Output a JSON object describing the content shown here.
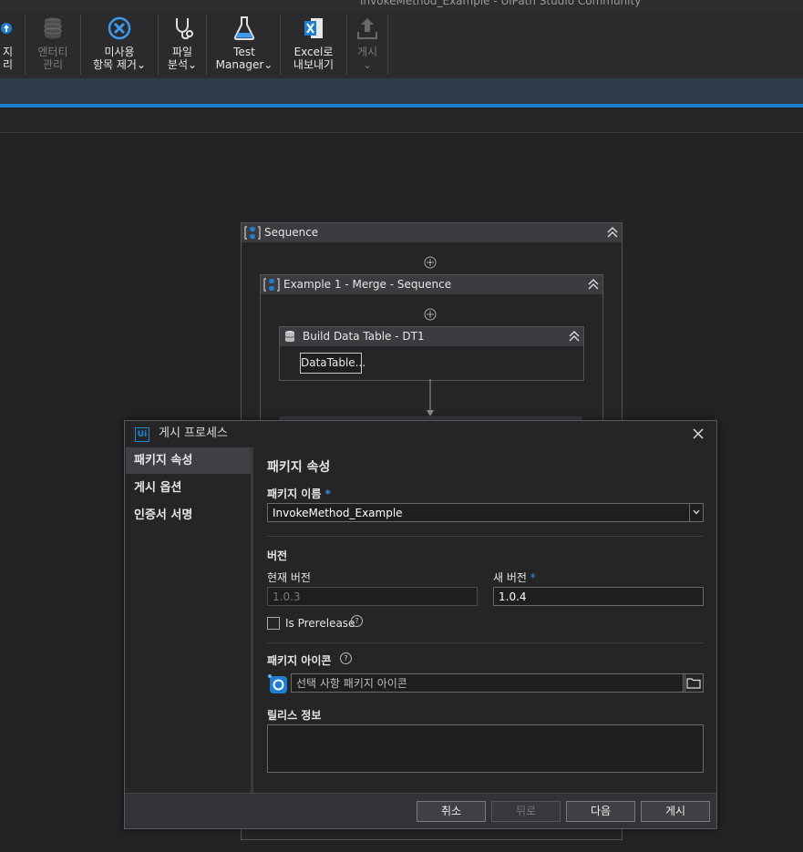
{
  "window": {
    "title": "InvokeMethod_Example - UiPath Studio Community"
  },
  "ribbon": {
    "partial_label_line1": "지",
    "partial_label_line2": "리",
    "entity_label_1": "엔터티",
    "entity_label_2": "관리",
    "remove_unused_label_1": "미사용",
    "remove_unused_label_2": "항목 제거",
    "file_analysis_label_1": "파일",
    "file_analysis_label_2": "분석",
    "test_manager_label_1": "Test",
    "test_manager_label_2": "Manager",
    "excel_export_label_1": "Excel로",
    "excel_export_label_2": "내보내기",
    "publish_label": "게시",
    "dropdown_glyph": "⌄"
  },
  "workflow": {
    "sequence_title": "Sequence",
    "example_title": "Example 1 - Merge - Sequence",
    "build_table_title": "Build Data Table - DT1",
    "datatable_button": "DataTable..."
  },
  "dialog": {
    "title": "게시 프로세스",
    "logo_text": "Ui",
    "nav": [
      "패키지 속성",
      "게시 옵션",
      "인증서 서명"
    ],
    "section_title": "패키지 속성",
    "package_name_label": "패키지 이름",
    "required_mark": "*",
    "package_name_value": "InvokeMethod_Example",
    "version_section": "버전",
    "current_version_label": "현재 버전",
    "current_version_value": "1.0.3",
    "new_version_label": "새 버전",
    "new_version_value": "1.0.4",
    "prerelease_label": "Is Prerelease",
    "help_glyph": "?",
    "package_icon_label": "패키지 아이콘",
    "package_icon_placeholder": "선택 사항 패키지 아이콘",
    "release_notes_label": "릴리스 정보",
    "buttons": {
      "cancel": "취소",
      "back": "뒤로",
      "next": "다음",
      "publish": "게시"
    }
  },
  "colors": {
    "accent": "#1e7fd1",
    "required": "#3a8de0"
  }
}
